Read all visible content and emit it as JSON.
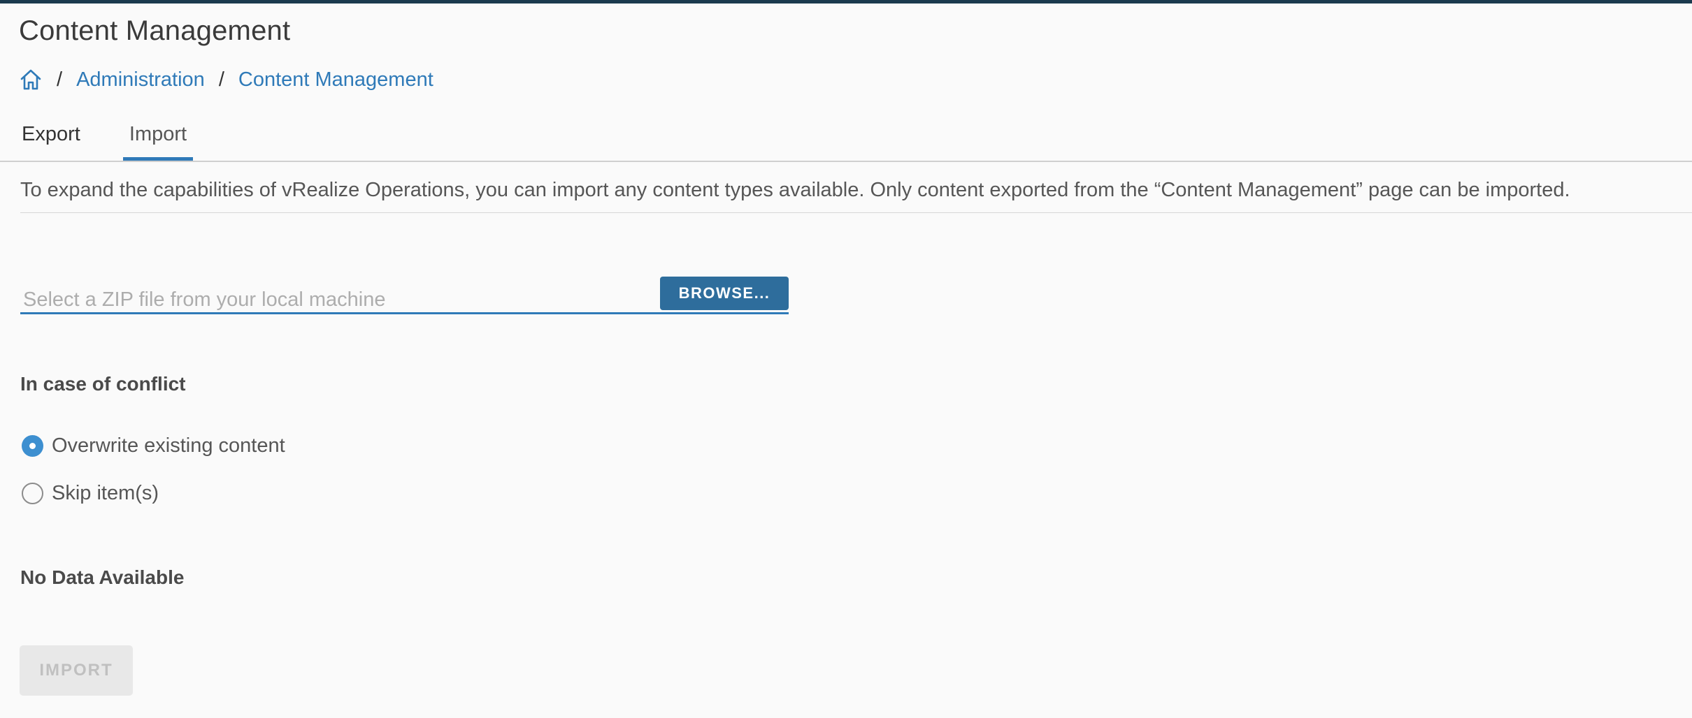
{
  "page": {
    "title": "Content Management"
  },
  "breadcrumb": {
    "home_icon": "home-icon",
    "separator": "/",
    "items": [
      "Administration",
      "Content Management"
    ]
  },
  "tabs": [
    {
      "label": "Export",
      "active": false
    },
    {
      "label": "Import",
      "active": true
    }
  ],
  "import": {
    "description": "To expand the capabilities of vRealize Operations, you can import any content types available. Only content exported from the “Content Management” page can be imported.",
    "file_input": {
      "value": "",
      "placeholder": "Select a ZIP file from your local machine"
    },
    "browse_label": "BROWSE...",
    "conflict": {
      "title": "In case of conflict",
      "options": [
        {
          "label": "Overwrite existing content",
          "selected": true
        },
        {
          "label": "Skip item(s)",
          "selected": false
        }
      ]
    },
    "no_data_text": "No Data Available",
    "import_label": "IMPORT",
    "import_enabled": false
  },
  "colors": {
    "accent": "#2f7ab8",
    "primary_button": "#2e6d9c",
    "radio_checked": "#3d8fd0",
    "header_bar": "#1b3a4e",
    "disabled_button_bg": "#e8e8e8",
    "disabled_button_text": "#c0c0c0"
  }
}
